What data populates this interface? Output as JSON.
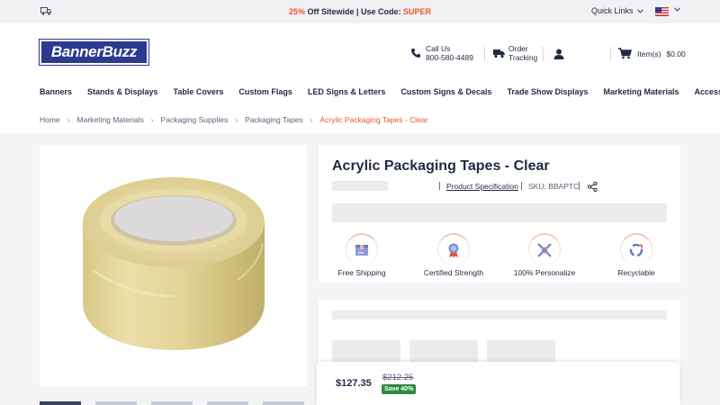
{
  "topbar": {
    "promo_accent": "25%",
    "promo_text": " Off Sitewide | Use Code: ",
    "promo_code": "SUPER",
    "quick_links": "Quick Links"
  },
  "header": {
    "logo": "BannerBuzz",
    "call_label": "Call Us",
    "call_number": "800-580-4489",
    "track_line1": "Order",
    "track_line2": "Tracking",
    "cart_label": "Item(s)",
    "cart_total": "$0.00"
  },
  "nav": [
    "Banners",
    "Stands & Displays",
    "Table Covers",
    "Custom Flags",
    "LED Signs & Letters",
    "Custom Signs & Decals",
    "Trade Show Displays",
    "Marketing Materials",
    "Accessories"
  ],
  "breadcrumb": [
    "Home",
    "Marketing Materials",
    "Packaging Supplies",
    "Packaging Tapes",
    "Acrylic Packaging Tapes - Clear"
  ],
  "product": {
    "title": "Acrylic Packaging Tapes - Clear",
    "spec_link": "Product Specification",
    "sku": "SKU: BBAPTC",
    "features": [
      "Free Shipping",
      "Certified Strength",
      "100% Personalize",
      "Recyclable"
    ]
  },
  "pricing": {
    "price": "$127.35",
    "old_price": "$212.25",
    "save": "Save 40%"
  },
  "colors": {
    "navy": "#1f2a44",
    "accent": "#e8542a",
    "logo_blue": "#2c3a8f",
    "save_green": "#2e8b3e"
  }
}
